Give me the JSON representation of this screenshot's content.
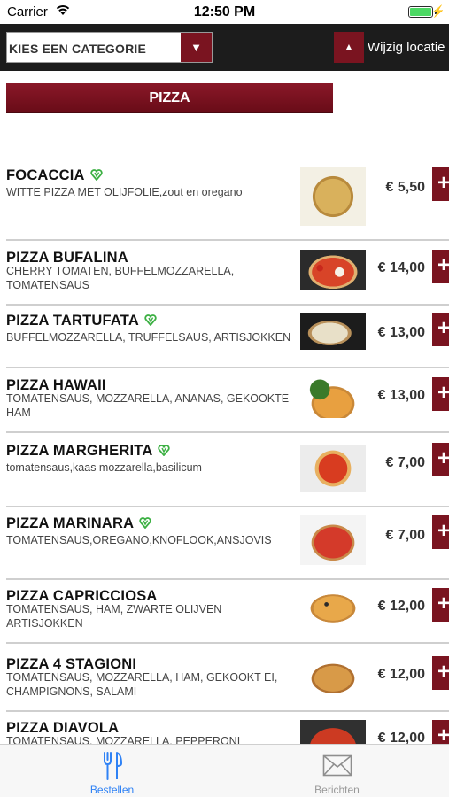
{
  "status_bar": {
    "carrier": "Carrier",
    "time": "12:50 PM",
    "battery_level": 1.0
  },
  "toolbar": {
    "category_label": "KIES EEN CATEGORIE",
    "category_arrow": "▼",
    "location_arrow": "▲",
    "location_label": "Wijzig locatie"
  },
  "category_banner": "PIZZA",
  "menu_items": [
    {
      "name": "FOCACCIA",
      "vegetarian": true,
      "description": "WITTE PIZZA MET OLIJFOLIE,zout en oregano",
      "price": "€ 5,50",
      "add_label": "+"
    },
    {
      "name": "PIZZA BUFALINA",
      "vegetarian": false,
      "description": "CHERRY TOMATEN, BUFFELMOZZARELLA, TOMATENSAUS",
      "price": "€ 14,00",
      "add_label": "+"
    },
    {
      "name": "PIZZA TARTUFATA",
      "vegetarian": true,
      "description": "BUFFELMOZZARELLA, TRUFFELSAUS, ARTISJOKKEN",
      "price": "€ 13,00",
      "add_label": "+"
    },
    {
      "name": "PIZZA HAWAII",
      "vegetarian": false,
      "description": "TOMATENSAUS, MOZZARELLA, ANANAS, GEKOOKTE HAM",
      "price": "€ 13,00",
      "add_label": "+"
    },
    {
      "name": "PIZZA MARGHERITA",
      "vegetarian": true,
      "description": "tomatensaus,kaas mozzarella,basilicum",
      "price": "€ 7,00",
      "add_label": "+"
    },
    {
      "name": "PIZZA MARINARA",
      "vegetarian": true,
      "description": "TOMATENSAUS,OREGANO,KNOFLOOK,ANSJOVIS",
      "price": "€ 7,00",
      "add_label": "+"
    },
    {
      "name": "PIZZA CAPRICCIOSA",
      "vegetarian": false,
      "description": "TOMATENSAUS, HAM, ZWARTE OLIJVEN ARTISJOKKEN",
      "price": "€ 12,00",
      "add_label": "+"
    },
    {
      "name": "PIZZA 4 STAGIONI",
      "vegetarian": false,
      "description": "TOMATENSAUS, MOZZARELLA, HAM, GEKOOKT EI, CHAMPIGNONS, SALAMI",
      "price": "€ 12,00",
      "add_label": "+"
    },
    {
      "name": "PIZZA DIAVOLA",
      "vegetarian": false,
      "description": "TOMATENSAUS, MOZZARELLA, PEPPERONI",
      "price": "€ 12,00",
      "add_label": "+"
    }
  ],
  "tab_bar": {
    "tabs": [
      {
        "label": "Bestellen",
        "icon": "fork-knife-icon",
        "active": true
      },
      {
        "label": "Berichten",
        "icon": "envelope-icon",
        "active": false
      }
    ]
  },
  "colors": {
    "accent": "#7a1420",
    "active_tab": "#2f82f5",
    "veg_icon": "#3cb043",
    "battery": "#4cd964"
  }
}
